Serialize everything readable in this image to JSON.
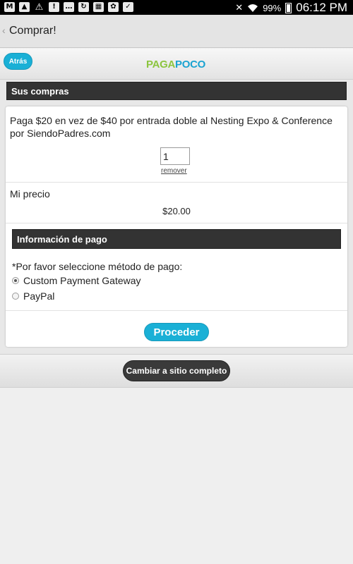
{
  "status_bar": {
    "icons": [
      "gmail-icon",
      "image-icon",
      "warning-icon",
      "alert-icon",
      "message-icon",
      "sync-icon",
      "calendar-icon",
      "settings-icon",
      "briefcase-icon"
    ],
    "battery_percent": "99%",
    "time": "06:12 PM"
  },
  "action_bar": {
    "back_glyph": "‹",
    "title": "Comprar!"
  },
  "page_header": {
    "back_label": "Atrás",
    "logo_part1": "PAGA",
    "logo_part2": "POCO"
  },
  "purchases": {
    "section_title": "Sus compras",
    "item_description": "Paga $20 en vez de $40 por entrada doble al Nesting Expo & Conference por SiendoPadres.com",
    "quantity": "1",
    "remove_label": "remover",
    "my_price_label": "Mi precio",
    "price": "$20.00"
  },
  "payment": {
    "section_title": "Información de pago",
    "prompt": "*Por favor seleccione método de pago:",
    "options": [
      {
        "label": "Custom Payment Gateway",
        "selected": true
      },
      {
        "label": "PayPal",
        "selected": false
      }
    ],
    "proceed_label": "Proceder"
  },
  "footer": {
    "full_site_label": "Cambiar a sitio completo"
  },
  "colors": {
    "accent": "#1ab0d6",
    "logo_green": "#8cc53f",
    "logo_blue": "#1aa3d1",
    "dark_bar": "#333333"
  }
}
